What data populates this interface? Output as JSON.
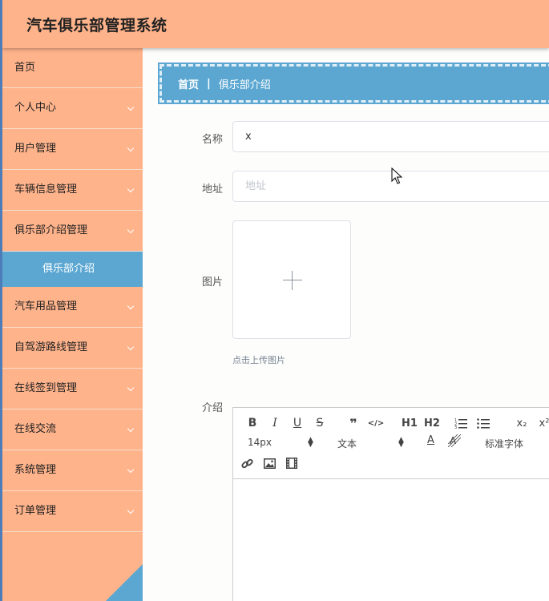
{
  "app": {
    "title": "汽车俱乐部管理系统"
  },
  "sidebar": {
    "items": [
      {
        "label": "首页"
      },
      {
        "label": "个人中心"
      },
      {
        "label": "用户管理"
      },
      {
        "label": "车辆信息管理"
      },
      {
        "label": "俱乐部介绍管理"
      },
      {
        "label": "汽车用品管理"
      },
      {
        "label": "自驾游路线管理"
      },
      {
        "label": "在线签到管理"
      },
      {
        "label": "在线交流"
      },
      {
        "label": "系统管理"
      },
      {
        "label": "订单管理"
      }
    ],
    "sub_item": {
      "label": "俱乐部介绍"
    }
  },
  "breadcrumb": {
    "home": "首页",
    "separator": "|",
    "current": "俱乐部介绍"
  },
  "form": {
    "name": {
      "label": "名称",
      "value": "x"
    },
    "address": {
      "label": "地址",
      "placeholder": "地址",
      "value": ""
    },
    "image": {
      "label": "图片",
      "tip": "点击上传图片"
    },
    "intro": {
      "label": "介绍"
    }
  },
  "editor": {
    "font_size": "14px",
    "text_type": "文本",
    "font_family": "标准字体",
    "buttons": {
      "bold": "B",
      "italic": "I",
      "underline": "U",
      "strike": "S",
      "quote": "❞",
      "code": "</>",
      "h1": "H1",
      "h2": "H2",
      "sub": "x₂",
      "sup": "x²"
    }
  },
  "colors": {
    "accent": "#ffb38b",
    "primary": "#5ba7d2"
  }
}
